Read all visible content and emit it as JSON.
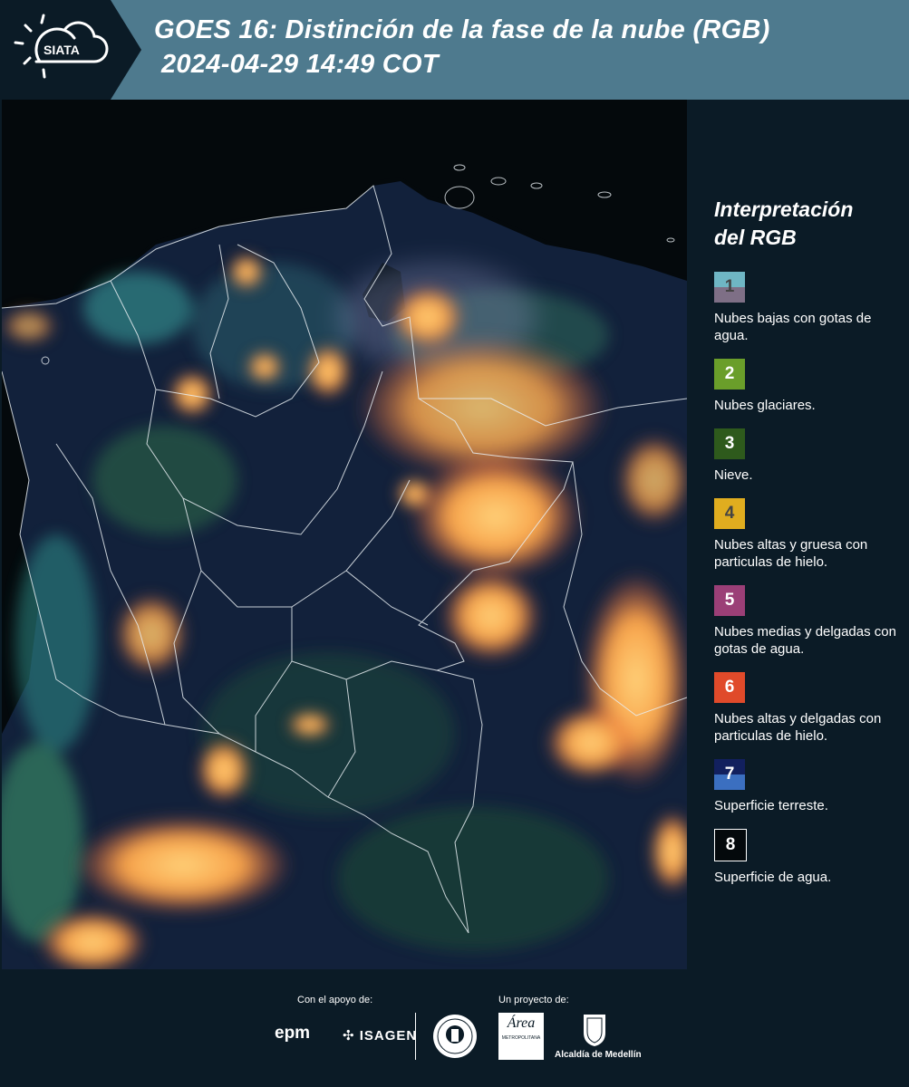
{
  "header": {
    "logo_text": "SIATA",
    "title_line1": "GOES 16: Distinción de la fase de la nube (RGB)",
    "title_line2": "2024-04-29 14:49 COT"
  },
  "legend": {
    "title_line1": "Interpretación",
    "title_line2": "del RGB",
    "items": [
      {
        "number": "1",
        "label": "Nubes bajas con gotas de agua.",
        "color_top": "#6fb6c4",
        "color_bottom": "#7e6f86",
        "text_color": "#444444"
      },
      {
        "number": "2",
        "label": "Nubes glaciares.",
        "color_top": "#6a9e2a",
        "color_bottom": "#6a9e2a",
        "text_color": "#ffffff"
      },
      {
        "number": "3",
        "label": "Nieve.",
        "color_top": "#2e5a1c",
        "color_bottom": "#2e5a1c",
        "text_color": "#ffffff"
      },
      {
        "number": "4",
        "label": "Nubes altas y gruesa con particulas de hielo.",
        "color_top": "#e0ad1f",
        "color_bottom": "#e0ad1f",
        "text_color": "#444444"
      },
      {
        "number": "5",
        "label": "Nubes medias y delgadas con gotas de agua.",
        "color_top": "#9b3f77",
        "color_bottom": "#9b3f77",
        "text_color": "#ffffff"
      },
      {
        "number": "6",
        "label": "Nubes altas y delgadas con particulas de hielo.",
        "color_top": "#e04a2a",
        "color_bottom": "#e04a2a",
        "text_color": "#ffffff"
      },
      {
        "number": "7",
        "label": "Superficie terreste.",
        "color_top": "#12205e",
        "color_bottom": "#3b6fc0",
        "text_color": "#ffffff"
      },
      {
        "number": "8",
        "label": "Superficie de agua.",
        "color_top": "#04090c",
        "color_bottom": "#04090c",
        "text_color": "#ffffff"
      }
    ]
  },
  "footer": {
    "support_label": "Con el apoyo de:",
    "project_label": "Un proyecto de:",
    "sponsor_epm": "epm",
    "sponsor_isagen": "ISAGEN",
    "area_logo_text": "Área",
    "area_logo_sub": "METROPOLITANA",
    "alcaldia_label": "Alcaldía de Medellín"
  }
}
